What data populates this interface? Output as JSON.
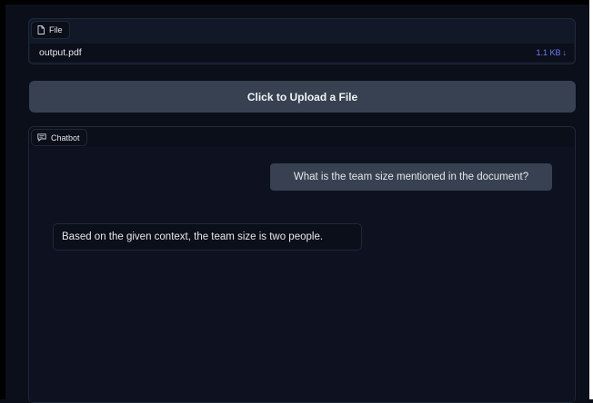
{
  "file_component": {
    "label": "File",
    "icon": "file-icon",
    "file_name": "output.pdf",
    "file_size": "1.1 KB",
    "download_icon": "download-arrow-icon",
    "download_glyph": "↓"
  },
  "upload": {
    "button_label": "Click to Upload a File"
  },
  "chatbot": {
    "label": "Chatbot",
    "icon": "chat-icon",
    "messages": [
      {
        "role": "user",
        "text": "What is the team size mentioned in the document?"
      },
      {
        "role": "bot",
        "text": "Based on the given context, the team size is two people."
      }
    ]
  },
  "colors": {
    "background": "#0b0f19",
    "panel": "#111827",
    "button": "#374151",
    "accent_link": "#6b7cff"
  }
}
